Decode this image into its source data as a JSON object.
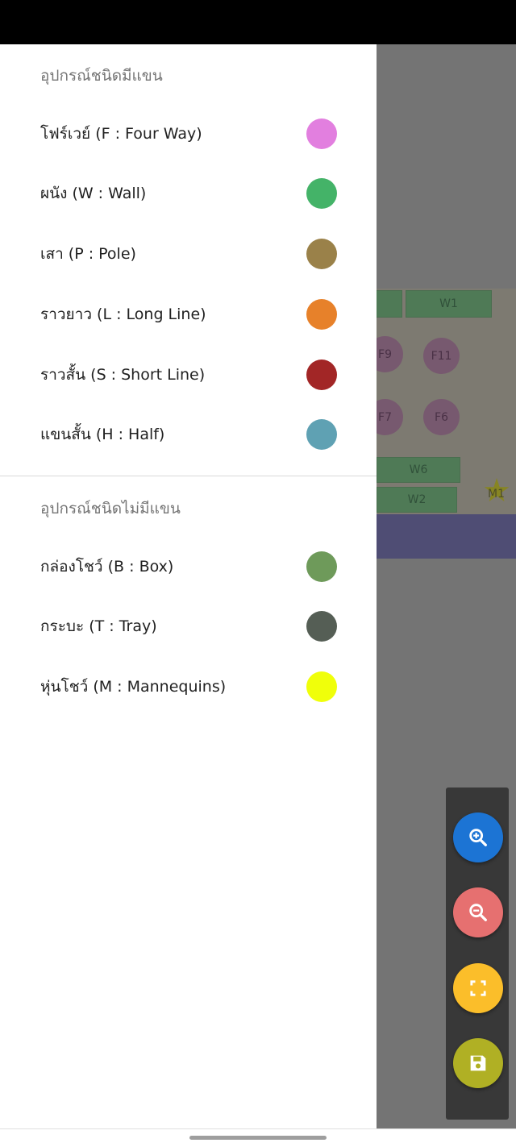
{
  "map": {
    "fixtures": [
      {
        "label": "W1",
        "shape": "rect"
      },
      {
        "label": "F9",
        "shape": "circle"
      },
      {
        "label": "F11",
        "shape": "circle"
      },
      {
        "label": "F7",
        "shape": "circle"
      },
      {
        "label": "F6",
        "shape": "circle"
      },
      {
        "label": "W6",
        "shape": "rect"
      },
      {
        "label": "W2",
        "shape": "rect"
      },
      {
        "label": "M1",
        "shape": "star"
      }
    ]
  },
  "drawer": {
    "section_with_arms": {
      "title": "อุปกรณ์ชนิดมีแขน",
      "items": [
        {
          "label": "โฟร์เวย์ (F : Four Way)",
          "color": "#E27FDF"
        },
        {
          "label": "ผนัง (W : Wall)",
          "color": "#44B368"
        },
        {
          "label": "เสา (P : Pole)",
          "color": "#9A8149"
        },
        {
          "label": "ราวยาว (L : Long Line)",
          "color": "#E7812A"
        },
        {
          "label": "ราวสั้น (S : Short Line)",
          "color": "#A22626"
        },
        {
          "label": "แขนสั้น (H : Half)",
          "color": "#5FA1B3"
        }
      ]
    },
    "section_without_arms": {
      "title": "อุปกรณ์ชนิดไม่มีแขน",
      "items": [
        {
          "label": "กล่องโชว์ (B : Box)",
          "color": "#6E9A5A"
        },
        {
          "label": "กระบะ (T : Tray)",
          "color": "#555E55"
        },
        {
          "label": "หุ่นโชว์ (M : Mannequins)",
          "color": "#F0FF0A"
        }
      ]
    }
  },
  "fab": {
    "zoom_in": {
      "icon": "zoom-in-icon",
      "color": "#1C74D4"
    },
    "zoom_out": {
      "icon": "zoom-out-icon",
      "color": "#E67070"
    },
    "fit": {
      "icon": "fullscreen-icon",
      "color": "#FBBE2A"
    },
    "save": {
      "icon": "save-icon",
      "color": "#B0B024"
    }
  }
}
